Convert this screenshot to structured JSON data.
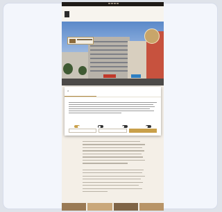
{
  "topbar": {
    "left": "",
    "right": ""
  },
  "header": {
    "brand": "",
    "nav": [
      "",
      "",
      "",
      "",
      ""
    ]
  },
  "hero": {
    "badge": ""
  },
  "cookie_dialog": {
    "close": "×",
    "logo": "",
    "tabs": [
      "",
      "",
      ""
    ],
    "title": "",
    "toggles": [
      {
        "label": "",
        "state": "on"
      },
      {
        "label": "",
        "state": "off"
      },
      {
        "label": "",
        "state": "off"
      },
      {
        "label": "",
        "state": "off"
      }
    ],
    "buttons": [
      "",
      "",
      ""
    ]
  },
  "colors": {
    "accent": "#c9a04a",
    "topbar": "#1f1b17",
    "page_bg": "#f4efe7"
  }
}
